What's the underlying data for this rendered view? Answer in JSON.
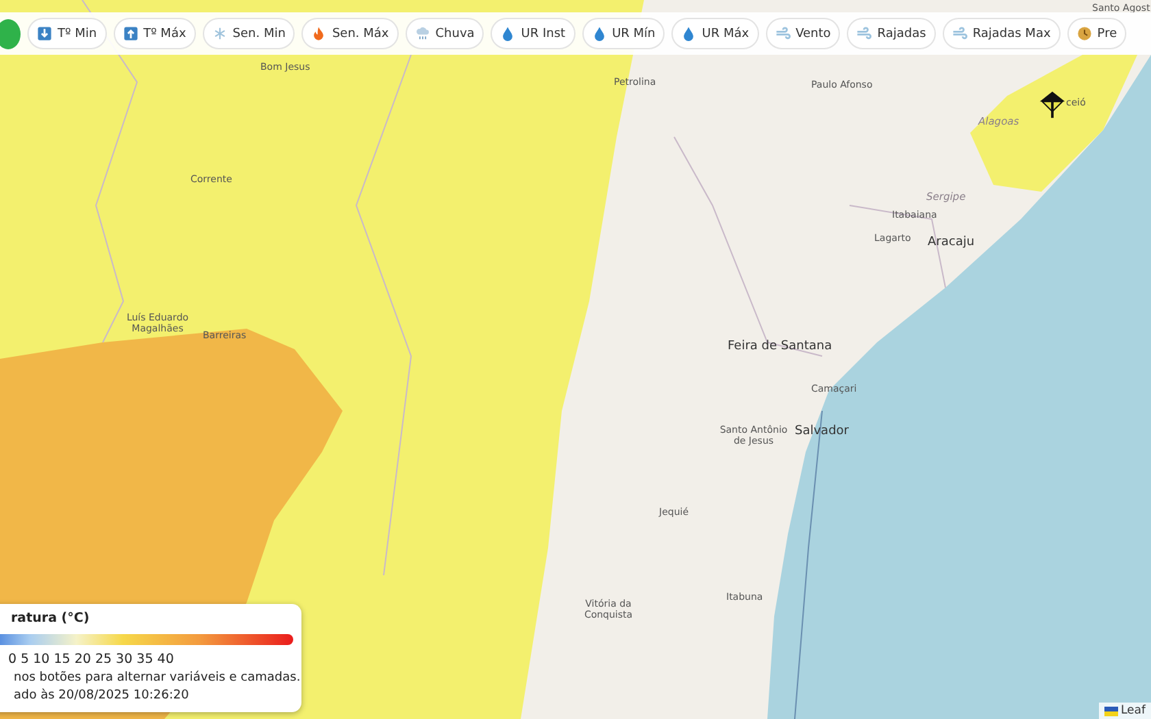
{
  "toolbar": {
    "buttons": [
      {
        "kind": "dot"
      },
      {
        "kind": "variable",
        "label": "Tº Min"
      },
      {
        "kind": "variable",
        "label": "Tº Máx"
      },
      {
        "kind": "variable",
        "label": "Sen. Min"
      },
      {
        "kind": "variable",
        "label": "Sen. Máx"
      },
      {
        "kind": "variable",
        "label": "Chuva"
      },
      {
        "kind": "variable",
        "label": "UR Inst"
      },
      {
        "kind": "variable",
        "label": "UR Mín"
      },
      {
        "kind": "variable",
        "label": "UR Máx"
      },
      {
        "kind": "variable",
        "label": "Vento"
      },
      {
        "kind": "variable",
        "label": "Rajadas"
      },
      {
        "kind": "variable",
        "label": "Rajadas Max"
      },
      {
        "kind": "variable",
        "label": "Pre"
      }
    ]
  },
  "map": {
    "labels": [
      {
        "kind": "city",
        "text": "Bom Jesus"
      },
      {
        "kind": "city",
        "text": "Petrolina"
      },
      {
        "kind": "city",
        "text": "Paulo Afonso"
      },
      {
        "kind": "city",
        "text": "Santo Agost"
      },
      {
        "kind": "state",
        "text": "Alagoas"
      },
      {
        "kind": "city",
        "text": "ceió"
      },
      {
        "kind": "state",
        "text": "Sergipe"
      },
      {
        "kind": "city",
        "text": "Itabaiana"
      },
      {
        "kind": "city",
        "text": "Lagarto"
      },
      {
        "kind": "bigcity",
        "text": "Aracaju"
      },
      {
        "kind": "city",
        "text": "Corrente"
      },
      {
        "kind": "city",
        "text": "Luís Eduardo Magalhães"
      },
      {
        "kind": "city",
        "text": "Barreiras"
      },
      {
        "kind": "bigcity",
        "text": "Feira de Santana"
      },
      {
        "kind": "city",
        "text": "Camaçari"
      },
      {
        "kind": "city",
        "text": "Santo Antônio de Jesus"
      },
      {
        "kind": "bigcity",
        "text": "Salvador"
      },
      {
        "kind": "city",
        "text": "Jequié"
      },
      {
        "kind": "city",
        "text": "Itabuna"
      },
      {
        "kind": "city",
        "text": "Vitória da Conquista"
      }
    ],
    "attribution": "Leaf"
  },
  "legend": {
    "title": "ratura (°C)",
    "scale": "0 5 10 15 20 25 30 35 40",
    "hint": "nos botões para alternar variáveis e camadas.",
    "updated": "ado às 20/08/2025 10:26:20"
  }
}
